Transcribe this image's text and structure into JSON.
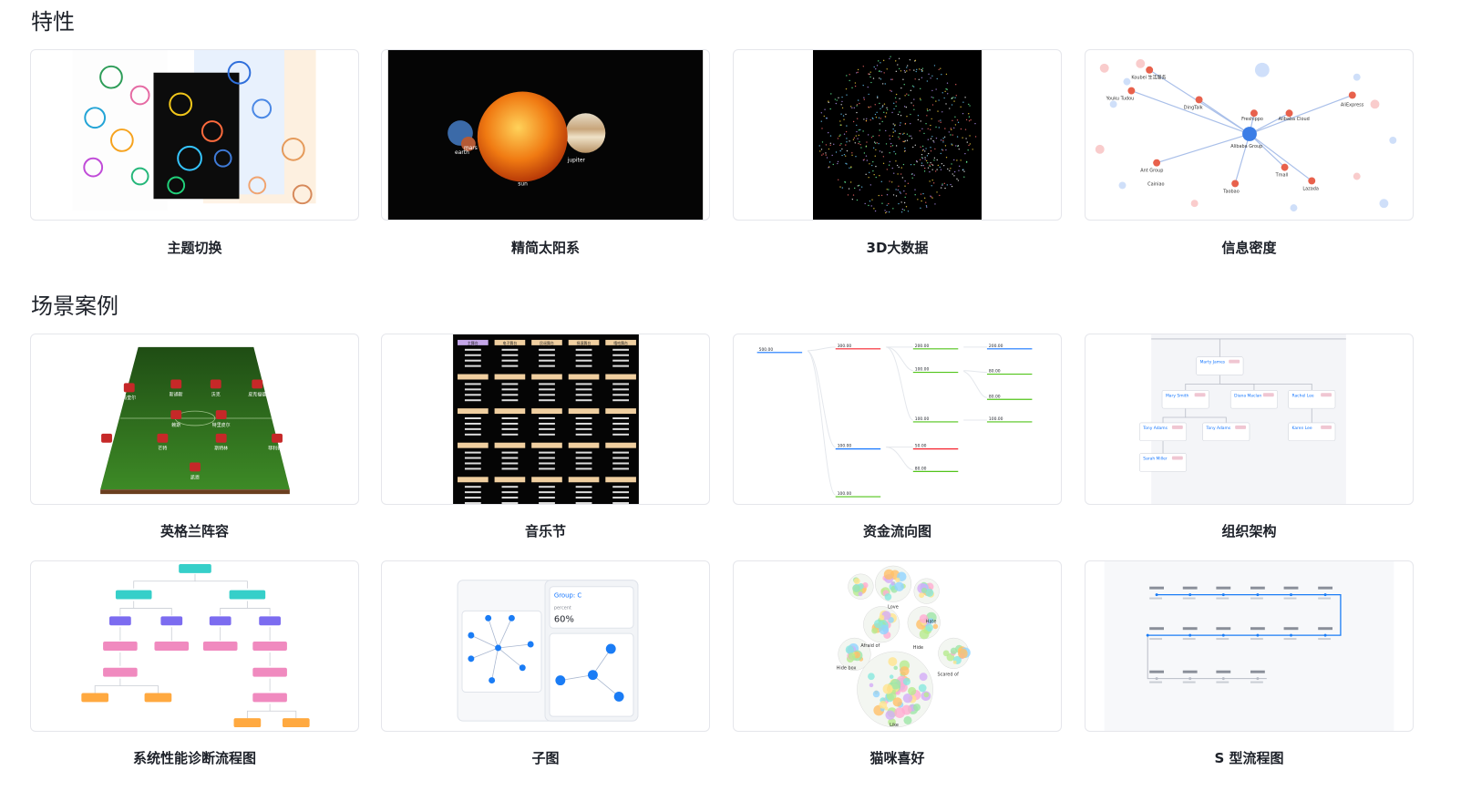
{
  "sections": {
    "features": {
      "title": "特性",
      "items": [
        {
          "label": "主题切换"
        },
        {
          "label": "精简太阳系",
          "planets": [
            "mars",
            "earth",
            "sun",
            "jupiter"
          ]
        },
        {
          "label": "3D大数据"
        },
        {
          "label": "信息密度",
          "nodes": [
            "Alibaba Group",
            "Koubei 生活服务",
            "Youku Tudou",
            "DingTalk",
            "Freshippo",
            "Alibaba Cloud",
            "AliExpress",
            "Ant Group",
            "Taobao",
            "Tmall",
            "Lazada",
            "Cainiao"
          ]
        }
      ]
    },
    "cases": {
      "title": "场景案例",
      "items": [
        {
          "label": "英格兰阵容",
          "players": [
            "皮克福德",
            "沃克",
            "斯通斯",
            "马奎尔",
            "特里皮尔",
            "赖斯",
            "菲利普斯",
            "斯特林",
            "芒特",
            "萨卡",
            "凯恩"
          ]
        },
        {
          "label": "音乐节",
          "stages": [
            "主舞台",
            "电子舞台",
            "民谣舞台",
            "摇滚舞台",
            "嘻哈舞台"
          ]
        },
        {
          "label": "资金流向图",
          "values": [
            "500.00",
            "300.00",
            "200.00",
            "100.00",
            "80.00",
            "50.00"
          ]
        },
        {
          "label": "组织架构",
          "people": [
            "Marty James",
            "Mary Smith",
            "Diana Maclan",
            "Rachel Lee",
            "Tony Adams",
            "Karen Lee",
            "Sarah Miller"
          ]
        }
      ]
    },
    "cases2": {
      "items": [
        {
          "label": "系统性能诊断流程图"
        },
        {
          "label": "子图",
          "group": "Group: C",
          "percent_label": "percent",
          "percent": "60%"
        },
        {
          "label": "猫咪喜好",
          "clusters": [
            "Love",
            "Hate",
            "Like",
            "Scared of",
            "Afraid of",
            "Hide",
            "Hide box"
          ]
        },
        {
          "label": "S 型流程图"
        }
      ]
    }
  },
  "colors": {
    "accent": "#1677ff",
    "title": "#1d2129",
    "border": "#e5e6eb"
  }
}
